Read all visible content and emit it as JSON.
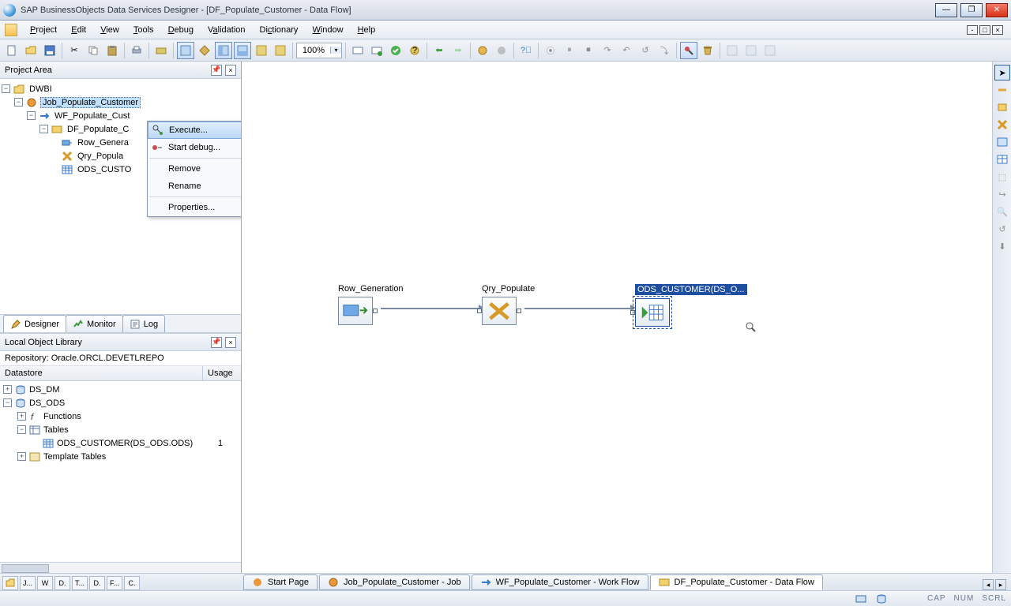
{
  "title": "SAP BusinessObjects Data Services Designer - [DF_Populate_Customer - Data Flow]",
  "menu": {
    "items": [
      "Project",
      "Edit",
      "View",
      "Tools",
      "Debug",
      "Validation",
      "Dictionary",
      "Window",
      "Help"
    ]
  },
  "zoom": "100%",
  "projectArea": {
    "title": "Project Area",
    "root": "DWBI",
    "job": "Job_Populate_Customer",
    "wf": "WF_Populate_Cust",
    "df": "DF_Populate_C",
    "children": [
      "Row_Genera",
      "Qry_Popula",
      "ODS_CUSTO"
    ]
  },
  "contextMenu": {
    "items": [
      "Execute...",
      "Start debug...",
      "Remove",
      "Rename",
      "Properties..."
    ]
  },
  "leftTabs": {
    "designer": "Designer",
    "monitor": "Monitor",
    "log": "Log"
  },
  "lol": {
    "title": "Local Object Library",
    "repo": "Repository: Oracle.ORCL.DEVETLREPO",
    "col1": "Datastore",
    "col2": "Usage",
    "ds1": "DS_DM",
    "ds2": "DS_ODS",
    "fn": "Functions",
    "tb": "Tables",
    "odsc": "ODS_CUSTOMER(DS_ODS.ODS)",
    "odsu": "1",
    "tt": "Template Tables"
  },
  "canvas": {
    "n1": "Row_Generation",
    "n2": "Qry_Populate",
    "n3": "ODS_CUSTOMER(DS_O..."
  },
  "docTabs": {
    "minis": [
      "J...",
      "W",
      "D.",
      "T...",
      "D.",
      "F...",
      "C."
    ],
    "start": "Start Page",
    "job": "Job_Populate_Customer - Job",
    "wf": "WF_Populate_Customer - Work Flow",
    "df": "DF_Populate_Customer - Data Flow"
  },
  "status": {
    "cap": "CAP",
    "num": "NUM",
    "scrl": "SCRL"
  }
}
